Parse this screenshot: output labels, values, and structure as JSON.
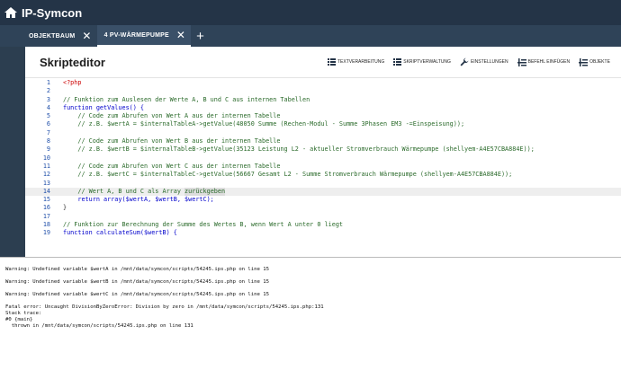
{
  "app": {
    "title": "IP-Symcon"
  },
  "tabs": [
    {
      "label": "OBJEKTBAUM",
      "close": "✕"
    },
    {
      "label": "4 PV-WÄRMEPUMPE",
      "close": "✕"
    }
  ],
  "tab_add": "+",
  "editor": {
    "title": "Skripteditor",
    "toolbar": [
      {
        "icon": "list-icon",
        "label": "TEXTVERARBEITUNG"
      },
      {
        "icon": "list-icon",
        "label": "SKRIPTVERWALTUNG"
      },
      {
        "icon": "wrench-icon",
        "label": "EINSTELLUNGEN"
      },
      {
        "icon": "insert-icon",
        "label": "BEFEHL EINFÜGEN"
      },
      {
        "icon": "insert-icon",
        "label": "OBJEKTE"
      }
    ],
    "highlighted_line": 14,
    "code_lines": [
      {
        "n": "1",
        "text": "<?php"
      },
      {
        "n": "2",
        "text": ""
      },
      {
        "n": "3",
        "text": "// Funktion zum Auslesen der Werte A, B und C aus internen Tabellen"
      },
      {
        "n": "4",
        "text": "function getValues() {"
      },
      {
        "n": "5",
        "text": "    // Code zum Abrufen von Wert A aus der internen Tabelle"
      },
      {
        "n": "6",
        "text": "    // z.B. $wertA = $internalTableA->getValue(48050 Summe (Rechen-Modul - Summe 3Phasen EM3 -=Einspeisung));"
      },
      {
        "n": "7",
        "text": ""
      },
      {
        "n": "8",
        "text": "    // Code zum Abrufen von Wert B aus der internen Tabelle"
      },
      {
        "n": "9",
        "text": "    // z.B. $wertB = $internalTableB->getValue(35123 Leistung L2 - aktueller Stromverbrauch Wärmepumpe (shellyem-A4E57CBA884E));"
      },
      {
        "n": "10",
        "text": ""
      },
      {
        "n": "11",
        "text": "    // Code zum Abrufen von Wert C aus der internen Tabelle"
      },
      {
        "n": "12",
        "text": "    // z.B. $wertC = $internalTableC->getValue(56667 Gesamt L2 - Summe Stromverbrauch Wärmepumpe (shellyem-A4E57CBA884E));"
      },
      {
        "n": "13",
        "text": ""
      },
      {
        "n": "14",
        "text": "    // Wert A, B und C als Array ",
        "sel": "zurückgeben"
      },
      {
        "n": "15",
        "text": "    return array($wertA, $wertB, $wertC);"
      },
      {
        "n": "16",
        "text": "}"
      },
      {
        "n": "17",
        "text": ""
      },
      {
        "n": "18",
        "text": "// Funktion zur Berechnung der Summe des Wertes B, wenn Wert A unter 0 liegt"
      },
      {
        "n": "19",
        "text": "function calculateSum($wertB) {"
      }
    ]
  },
  "console_lines": [
    "Warning: Undefined variable $wertA in /mnt/data/symcon/scripts/54245.ips.php on line 15",
    "",
    "Warning: Undefined variable $wertB in /mnt/data/symcon/scripts/54245.ips.php on line 15",
    "",
    "Warning: Undefined variable $wertC in /mnt/data/symcon/scripts/54245.ips.php on line 15",
    "",
    "Fatal error: Uncaught DivisionByZeroError: Division by zero in /mnt/data/symcon/scripts/54245.ips.php:131",
    "Stack trace:",
    "#0 {main}",
    "  thrown in /mnt/data/symcon/scripts/54245.ips.php on line 131"
  ],
  "colors": {
    "topbar": "#243447",
    "tabbar": "#2f4358",
    "line_numbers": "#2251aa",
    "keyword": "#0000cc",
    "comment": "#2a6a2a"
  }
}
